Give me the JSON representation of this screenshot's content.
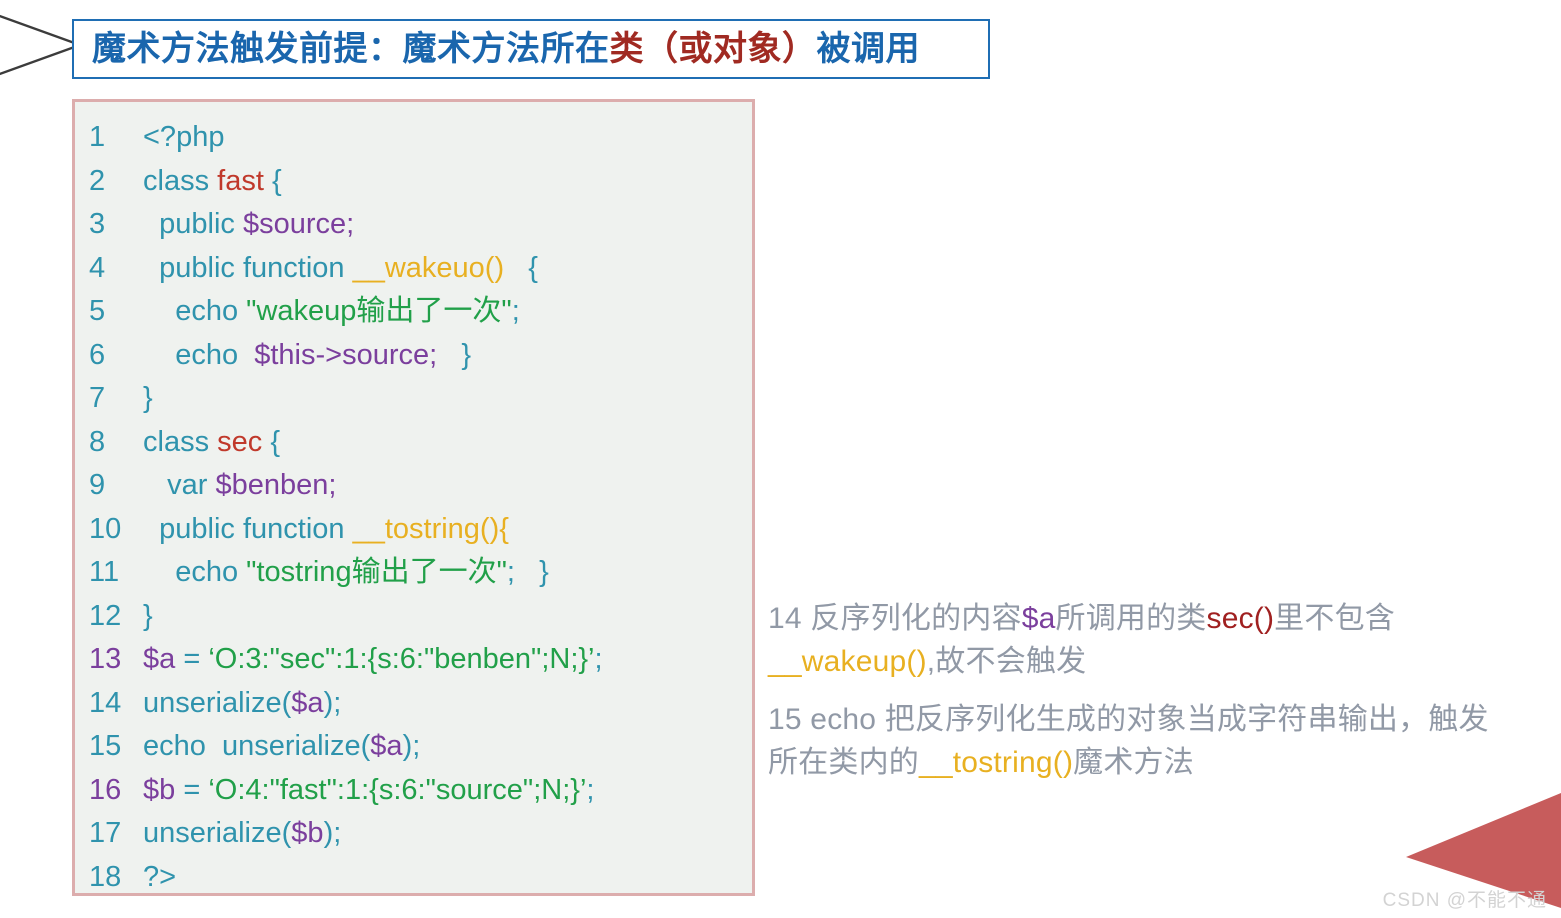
{
  "header": {
    "icon": "chevron-right-arrow",
    "text_before": "魔术方法触发前提：魔术方法所在",
    "text_accent": "类（或对象）",
    "text_after": "被调用"
  },
  "code": {
    "language": "php",
    "lines": [
      {
        "num": "1",
        "num_color": "teal",
        "tokens": [
          {
            "t": "<?php",
            "c": "kw"
          }
        ]
      },
      {
        "num": "2",
        "num_color": "teal",
        "tokens": [
          {
            "t": "class ",
            "c": "kw"
          },
          {
            "t": "fast",
            "c": "cls"
          },
          {
            "t": " {",
            "c": "kw"
          }
        ]
      },
      {
        "num": "3",
        "num_color": "teal",
        "tokens": [
          {
            "t": "  public ",
            "c": "kw"
          },
          {
            "t": "$source;",
            "c": "var"
          }
        ]
      },
      {
        "num": "4",
        "num_color": "teal",
        "tokens": [
          {
            "t": "  public function ",
            "c": "kw"
          },
          {
            "t": "__wakeuo()",
            "c": "fn"
          },
          {
            "t": "   {",
            "c": "kw"
          }
        ]
      },
      {
        "num": "5",
        "num_color": "teal",
        "tokens": [
          {
            "t": "    echo ",
            "c": "kw"
          },
          {
            "t": "\"wakeup输出了一次\"",
            "c": "str"
          },
          {
            "t": ";",
            "c": "kw"
          }
        ]
      },
      {
        "num": "6",
        "num_color": "teal",
        "tokens": [
          {
            "t": "    echo  ",
            "c": "kw"
          },
          {
            "t": "$this->source;",
            "c": "var"
          },
          {
            "t": "   }",
            "c": "kw"
          }
        ]
      },
      {
        "num": "7",
        "num_color": "teal",
        "tokens": [
          {
            "t": "}",
            "c": "kw"
          }
        ]
      },
      {
        "num": "8",
        "num_color": "teal",
        "tokens": [
          {
            "t": "class ",
            "c": "kw"
          },
          {
            "t": "sec",
            "c": "cls"
          },
          {
            "t": " {",
            "c": "kw"
          }
        ]
      },
      {
        "num": "9",
        "num_color": "teal",
        "tokens": [
          {
            "t": "   var ",
            "c": "kw"
          },
          {
            "t": "$benben;",
            "c": "var"
          }
        ]
      },
      {
        "num": "10",
        "num_color": "teal",
        "tokens": [
          {
            "t": "  public function ",
            "c": "kw"
          },
          {
            "t": "__tostring(){",
            "c": "fn"
          }
        ]
      },
      {
        "num": "11",
        "num_color": "teal",
        "tokens": [
          {
            "t": "    echo ",
            "c": "kw"
          },
          {
            "t": "\"tostring输出了一次\"",
            "c": "str"
          },
          {
            "t": ";   }",
            "c": "kw"
          }
        ]
      },
      {
        "num": "12",
        "num_color": "teal",
        "tokens": [
          {
            "t": "}",
            "c": "kw"
          }
        ]
      },
      {
        "num": "13",
        "num_color": "purple",
        "tokens": [
          {
            "t": "$a",
            "c": "var"
          },
          {
            "t": " = ",
            "c": "kw"
          },
          {
            "t": "‘O:3:\"sec\":1:{s:6:\"benben\";N;}’",
            "c": "str"
          },
          {
            "t": ";",
            "c": "kw"
          }
        ]
      },
      {
        "num": "14",
        "num_color": "teal",
        "tokens": [
          {
            "t": "unserialize(",
            "c": "kw"
          },
          {
            "t": "$a",
            "c": "var"
          },
          {
            "t": ");",
            "c": "kw"
          }
        ]
      },
      {
        "num": "15",
        "num_color": "teal",
        "tokens": [
          {
            "t": "echo  unserialize(",
            "c": "kw"
          },
          {
            "t": "$a",
            "c": "var"
          },
          {
            "t": ");",
            "c": "kw"
          }
        ]
      },
      {
        "num": "16",
        "num_color": "purple",
        "tokens": [
          {
            "t": "$b",
            "c": "var"
          },
          {
            "t": " = ",
            "c": "kw"
          },
          {
            "t": "‘O:4:\"fast\":1:{s:6:\"source\";N;}’",
            "c": "str"
          },
          {
            "t": ";",
            "c": "kw"
          }
        ]
      },
      {
        "num": "17",
        "num_color": "teal",
        "tokens": [
          {
            "t": "unserialize(",
            "c": "kw"
          },
          {
            "t": "$b",
            "c": "var"
          },
          {
            "t": ");",
            "c": "kw"
          }
        ]
      },
      {
        "num": "18",
        "num_color": "teal",
        "tokens": [
          {
            "t": "?>",
            "c": "kw"
          }
        ]
      }
    ]
  },
  "notes": [
    {
      "id": "note-line-14",
      "segments": [
        {
          "t": "14 反序列化的内容",
          "c": "plain"
        },
        {
          "t": "$a",
          "c": "var"
        },
        {
          "t": "所调用的类",
          "c": "plain"
        },
        {
          "t": "sec()",
          "c": "cls"
        },
        {
          "t": "里不包含",
          "c": "plain"
        },
        {
          "t": "__wakeup()",
          "c": "fn"
        },
        {
          "t": ",故不会触发",
          "c": "plain"
        }
      ]
    },
    {
      "id": "note-line-15",
      "segments": [
        {
          "t": "15 echo 把反序列化生成的对象当成字符串输出，触发所在类内的",
          "c": "plain"
        },
        {
          "t": "__tostring()",
          "c": "fn"
        },
        {
          "t": "魔术方法",
          "c": "plain"
        }
      ]
    }
  ],
  "decoration": {
    "triangle_color": "#c75c5c",
    "triangle_name": "red-triangle-accent"
  },
  "watermark": {
    "text": "CSDN @不能不通"
  },
  "colors": {
    "header_blue": "#1a66ad",
    "header_red": "#a02a22",
    "code_border": "#dcadad",
    "code_bg": "#eff2ef",
    "token_keyword": "#2f93ad",
    "token_class": "#c0392b",
    "token_variable": "#7b3f9d",
    "token_string": "#21a049",
    "token_function": "#e8b021",
    "note_gray": "#9199a6",
    "watermark_gray": "#d3d3d3"
  }
}
